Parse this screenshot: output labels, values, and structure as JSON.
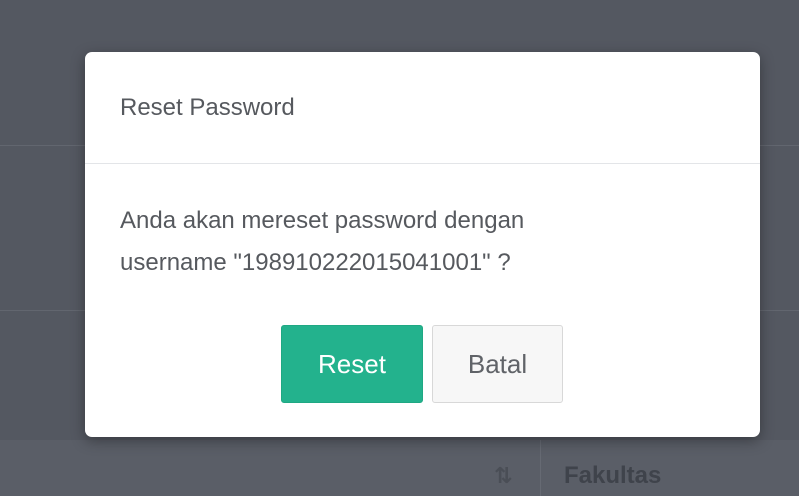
{
  "modal": {
    "title": "Reset Password",
    "message_line1": "Anda akan mereset password dengan",
    "message_line2": "username \"198910222015041001\" ?",
    "reset_label": "Reset",
    "cancel_label": "Batal"
  },
  "background": {
    "column_label": "Fakultas",
    "sort_icon_glyph": "⇅"
  },
  "colors": {
    "overlay": "#545861",
    "primary_button": "#23b28d",
    "cancel_button": "#f7f7f7"
  }
}
